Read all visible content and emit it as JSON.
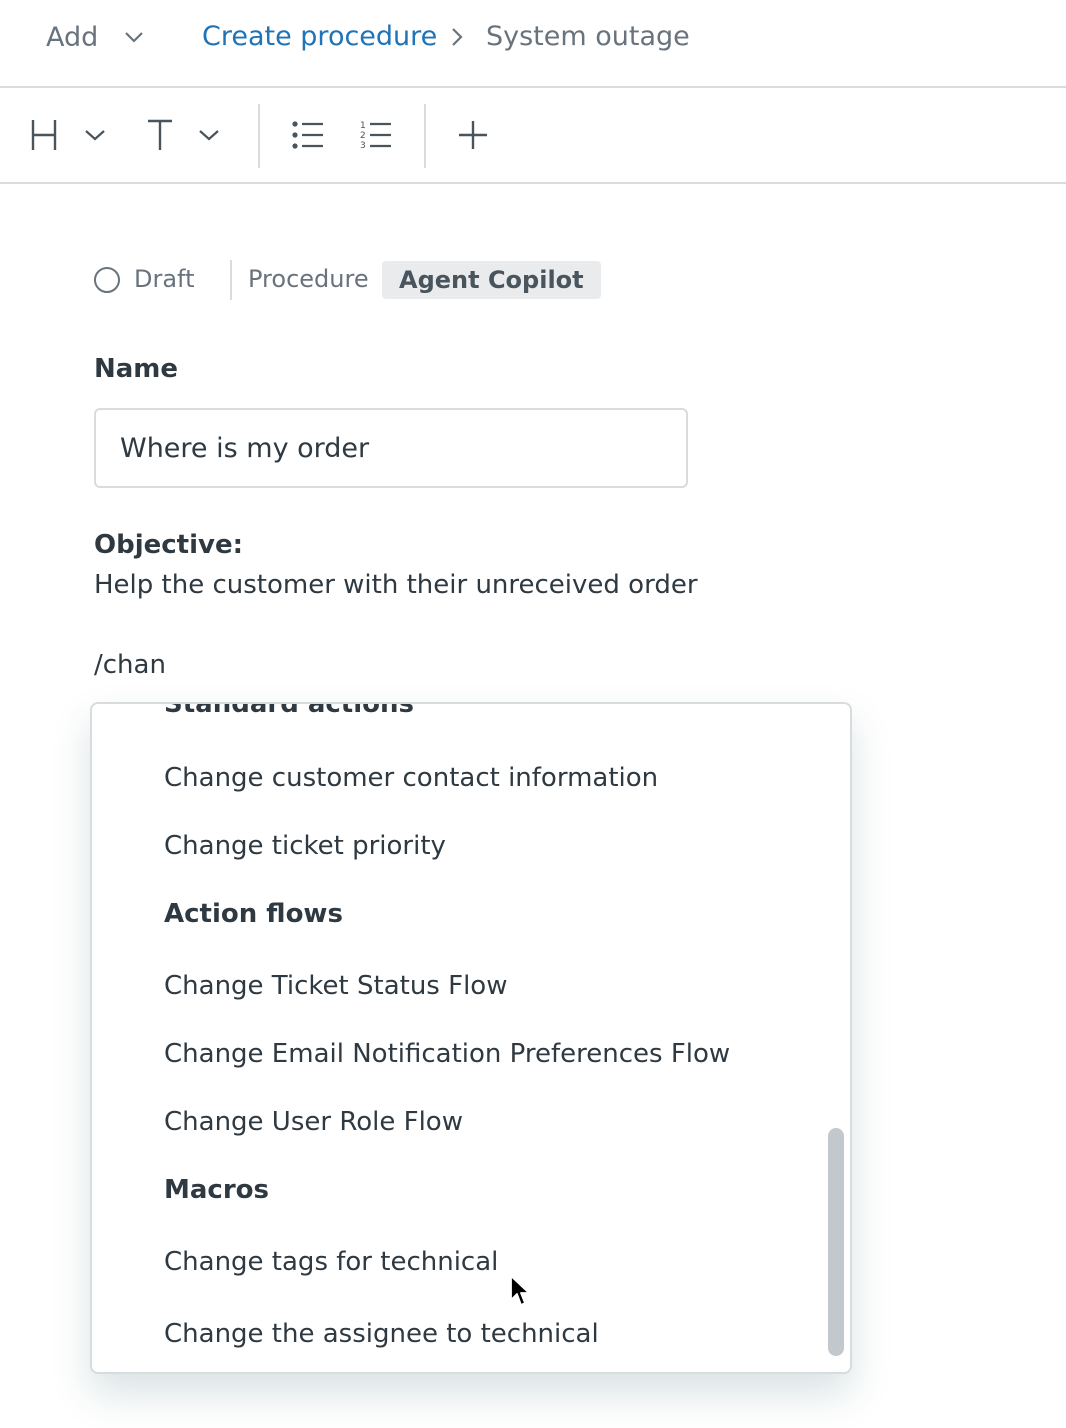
{
  "header": {
    "add_label": "Add",
    "breadcrumb": {
      "link_label": "Create procedure",
      "current_label": "System outage"
    }
  },
  "toolbar": {
    "icons": [
      "heading-icon",
      "chevron-down-icon",
      "text-icon",
      "chevron-down-icon",
      "bulleted-list-icon",
      "numbered-list-icon",
      "plus-icon"
    ]
  },
  "status": {
    "state_label": "Draft",
    "type_label": "Procedure",
    "tag_label": "Agent Copilot"
  },
  "form": {
    "name_label": "Name",
    "name_value": "Where is my order",
    "objective_label": "Objective:",
    "objective_text": "Help the customer with their unreceived order",
    "command_text": "/chan"
  },
  "menu": {
    "sections": [
      {
        "header": "Standard actions",
        "items": [
          "Change customer contact information",
          "Change ticket priority"
        ]
      },
      {
        "header": "Action flows",
        "items": [
          "Change Ticket Status Flow",
          "Change Email Notification Preferences Flow",
          "Change User Role Flow"
        ]
      },
      {
        "header": "Macros",
        "items": [
          "Change tags for technical",
          "Change the assignee to technical"
        ]
      }
    ]
  },
  "colors": {
    "link": "#1f73b7",
    "text": "#2f3941",
    "muted": "#68737d",
    "border": "#d8dcde",
    "tag_bg": "#e9ebed"
  }
}
